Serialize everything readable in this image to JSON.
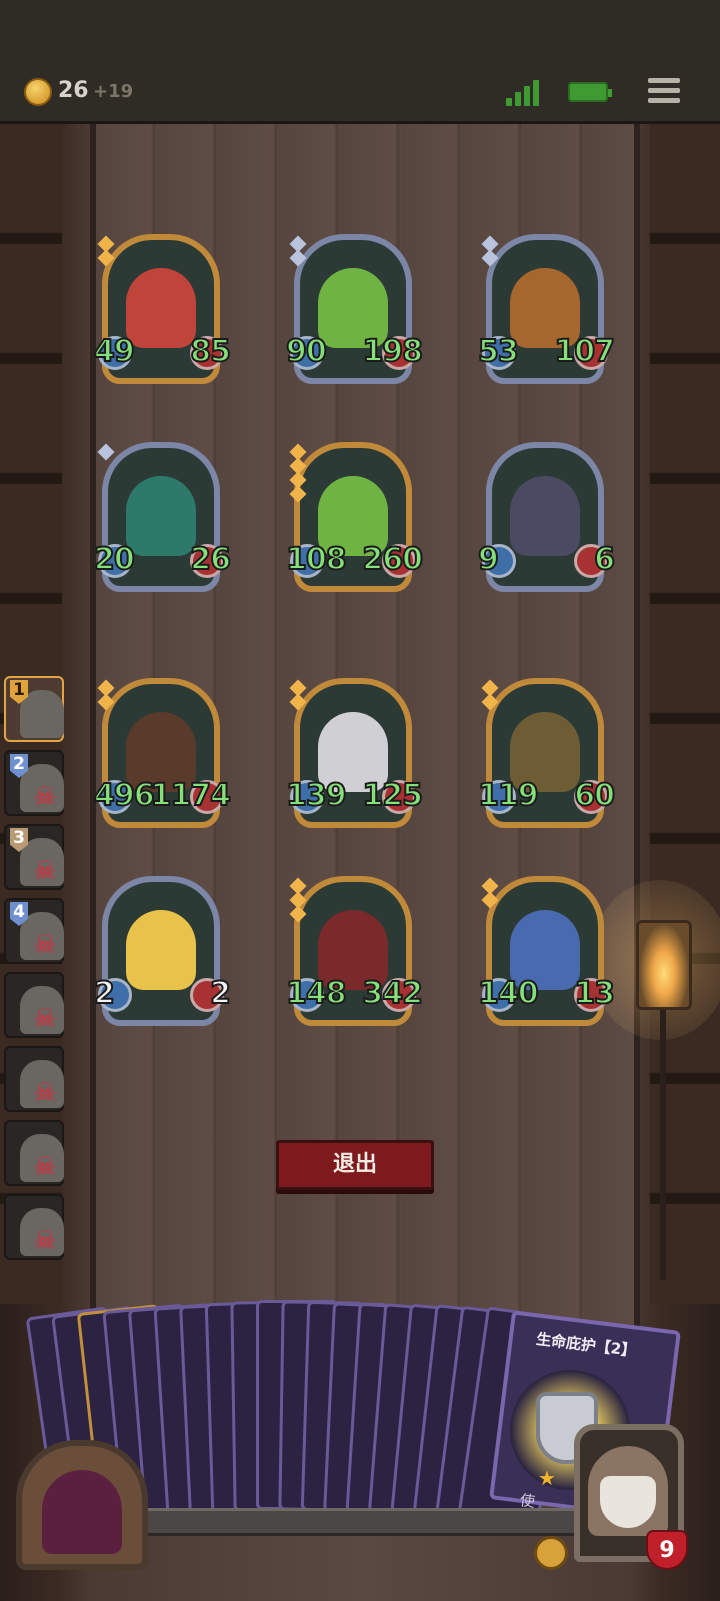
{
  "topbar": {
    "coins": "26",
    "coin_bonus": "+19"
  },
  "board": {
    "cards": [
      {
        "atk": "49",
        "hp": "85",
        "frame": "gold",
        "portrait_color": "#c0443a",
        "gems": 2
      },
      {
        "atk": "90",
        "hp": "198",
        "frame": "silver",
        "portrait_color": "#6fb443",
        "gems": 2
      },
      {
        "atk": "53",
        "hp": "107",
        "frame": "silver",
        "portrait_color": "#a6672e",
        "gems": 2
      },
      {
        "atk": "20",
        "hp": "26",
        "frame": "silver",
        "portrait_color": "#2e7a6a",
        "gems": 1
      },
      {
        "atk": "108",
        "hp": "260",
        "frame": "gold",
        "portrait_color": "#6fb443",
        "gems": 4
      },
      {
        "atk": "9",
        "hp": "6",
        "frame": "silver",
        "portrait_color": "#4a4a62",
        "gems": 0
      },
      {
        "atk": "496",
        "hp": "1174",
        "frame": "gold",
        "portrait_color": "#5a3a2a",
        "gems": 2
      },
      {
        "atk": "139",
        "hp": "125",
        "frame": "gold",
        "portrait_color": "#d0cfd4",
        "gems": 2
      },
      {
        "atk": "119",
        "hp": "60",
        "frame": "gold",
        "portrait_color": "#6d5c34",
        "gems": 2
      },
      {
        "atk": "2",
        "hp": "2",
        "frame": "silver",
        "portrait_color": "#e8c24a",
        "gems": 0
      },
      {
        "atk": "148",
        "hp": "342",
        "frame": "gold",
        "portrait_color": "#7a2a2a",
        "gems": 3
      },
      {
        "atk": "140",
        "hp": "13",
        "frame": "gold",
        "portrait_color": "#4a6ab0",
        "gems": 2
      }
    ]
  },
  "roster": [
    {
      "num": "1",
      "active": true,
      "dead": false,
      "badge": "gold"
    },
    {
      "num": "2",
      "active": false,
      "dead": true,
      "badge": "blue"
    },
    {
      "num": "3",
      "active": false,
      "dead": true,
      "badge": "tan"
    },
    {
      "num": "4",
      "active": false,
      "dead": true,
      "badge": "blue"
    },
    {
      "num": "",
      "active": false,
      "dead": true,
      "badge": ""
    },
    {
      "num": "",
      "active": false,
      "dead": true,
      "badge": ""
    },
    {
      "num": "",
      "active": false,
      "dead": true,
      "badge": ""
    },
    {
      "num": "",
      "active": false,
      "dead": true,
      "badge": ""
    }
  ],
  "exit_label": "退出",
  "hand": {
    "skill_title": "生命庇护【2】",
    "use_label": "使",
    "deck_card_count": 19
  },
  "hero": {
    "hp": "9"
  },
  "icons": [
    "crown-coin-icon",
    "signal-icon",
    "battery-icon",
    "menu-icon",
    "skull-icon",
    "shield-icon",
    "bell-icon",
    "star-icon",
    "heart-icon"
  ]
}
